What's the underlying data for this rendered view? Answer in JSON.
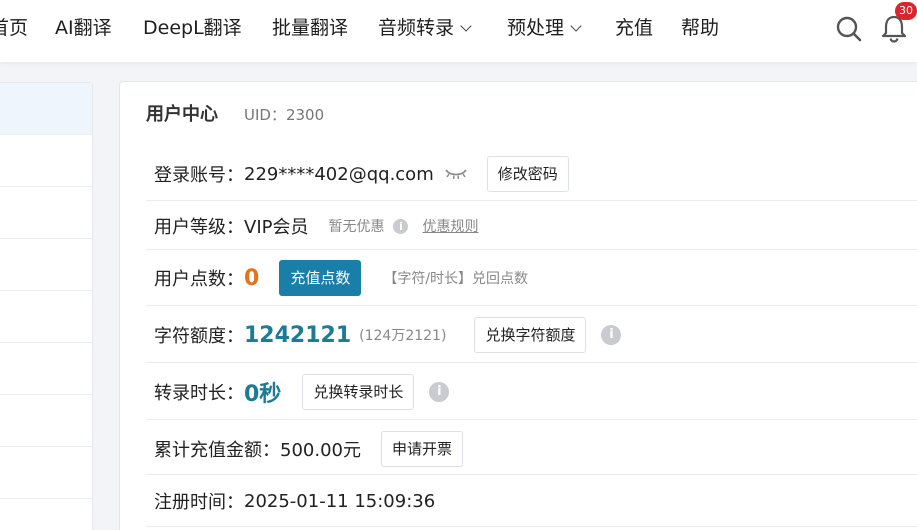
{
  "nav": {
    "items": [
      {
        "label": "首页"
      },
      {
        "label": "AI翻译"
      },
      {
        "label": "DeepL翻译"
      },
      {
        "label": "批量翻译"
      },
      {
        "label": "音频转录"
      },
      {
        "label": "预处理"
      },
      {
        "label": "充值"
      },
      {
        "label": "帮助"
      }
    ],
    "notification_count": "30"
  },
  "user_center": {
    "title": "用户中心",
    "uid": "UID：2300",
    "account": {
      "label": "登录账号：",
      "value": "229****402@qq.com",
      "button": "修改密码"
    },
    "level": {
      "label": "用户等级：",
      "value": "VIP会员",
      "discount": "暂无优惠",
      "rules_link": "优惠规则"
    },
    "points": {
      "label": "用户点数：",
      "value": "0",
      "button": "充值点数",
      "note": "【字符/时长】兑回点数"
    },
    "chars": {
      "label": "字符额度：",
      "value": "1242121",
      "sub": "(124万2121)",
      "button": "兑换字符额度"
    },
    "duration": {
      "label": "转录时长：",
      "value": "0秒",
      "button": "兑换转录时长"
    },
    "recharge_total": {
      "label": "累计充值金额：",
      "value": "500.00元",
      "button": "申请开票"
    },
    "register_time": {
      "label": "注册时间：",
      "value": "2025-01-11 15:09:36"
    }
  },
  "colors": {
    "primary": "#1a7fa8",
    "orange": "#e2751b",
    "teal": "#1c7b96",
    "badge": "#d9262c"
  },
  "icons": [
    "search-icon",
    "bell-icon",
    "eye-closed-icon",
    "info-icon",
    "chevron-down-icon"
  ]
}
